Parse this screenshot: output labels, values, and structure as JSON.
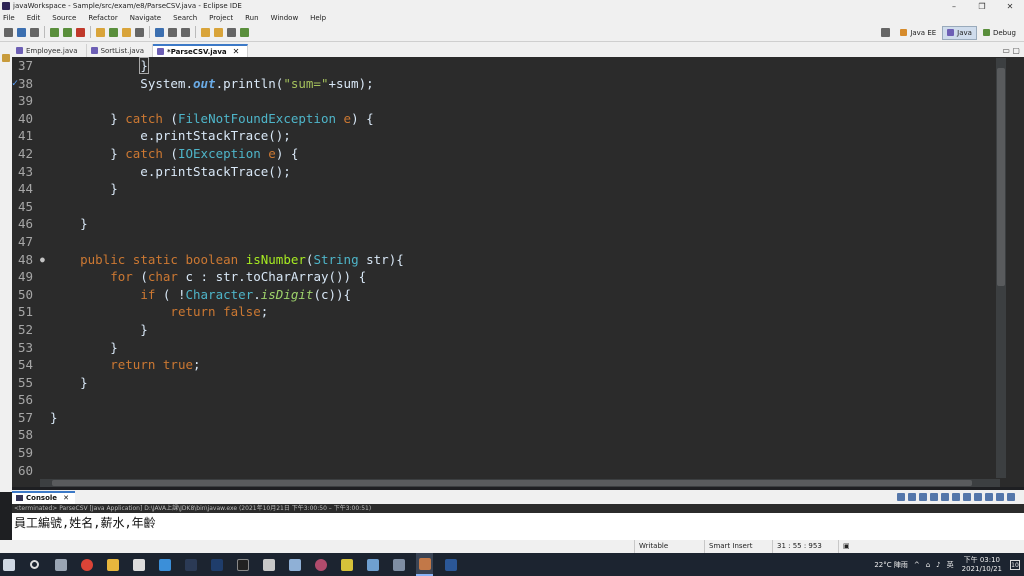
{
  "window": {
    "title": "javaWorkspace - Sample/src/exam/e8/ParseCSV.java - Eclipse IDE",
    "minimize": "–",
    "maximize": "❐",
    "close": "✕"
  },
  "menu": [
    "File",
    "Edit",
    "Source",
    "Refactor",
    "Navigate",
    "Search",
    "Project",
    "Run",
    "Window",
    "Help"
  ],
  "perspectives": [
    {
      "label": "Java EE",
      "active": false
    },
    {
      "label": "Java",
      "active": true
    },
    {
      "label": "Debug",
      "active": false
    }
  ],
  "editor_tabs": [
    {
      "label": "Employee.java",
      "active": false
    },
    {
      "label": "SortList.java",
      "active": false
    },
    {
      "label": "*ParseCSV.java",
      "active": true,
      "close": "✕"
    }
  ],
  "code_lines": [
    {
      "n": "37",
      "html": "<span class=\"pl\">            </span><span class=\"pl brk\">}</span>"
    },
    {
      "n": "38",
      "mark": "✓",
      "html": "<span class=\"pl\">            System.</span><span class=\"fld\">out</span><span class=\"pl\">.println(</span><span class=\"st\">\"sum=\"</span><span class=\"pl\">+sum);</span>"
    },
    {
      "n": "39",
      "html": ""
    },
    {
      "n": "40",
      "html": "<span class=\"pl\">        } </span><span class=\"kw\">catch</span><span class=\"pl\"> (</span><span class=\"ty\">FileNotFoundException</span><span class=\"pl\"> </span><span class=\"kw\">e</span><span class=\"pl\">) {</span>"
    },
    {
      "n": "41",
      "html": "<span class=\"pl\">            e.printStackTrace();</span>"
    },
    {
      "n": "42",
      "html": "<span class=\"pl\">        } </span><span class=\"kw\">catch</span><span class=\"pl\"> (</span><span class=\"ty\">IOException</span><span class=\"pl\"> </span><span class=\"kw\">e</span><span class=\"pl\">) {</span>"
    },
    {
      "n": "43",
      "html": "<span class=\"pl\">            e.printStackTrace();</span>"
    },
    {
      "n": "44",
      "html": "<span class=\"pl\">        }</span>"
    },
    {
      "n": "45",
      "html": ""
    },
    {
      "n": "46",
      "html": "<span class=\"pl\">    }</span>"
    },
    {
      "n": "47",
      "html": ""
    },
    {
      "n": "48",
      "dot": "●",
      "html": "<span class=\"pl\">    </span><span class=\"kw\">public static boolean</span><span class=\"pl\"> </span><span class=\"mth\">isNumber</span><span class=\"pl\">(</span><span class=\"ty\">String</span><span class=\"pl\"> </span><span class=\"var\">str</span><span class=\"pl\">){</span>"
    },
    {
      "n": "49",
      "html": "<span class=\"pl\">        </span><span class=\"kw\">for</span><span class=\"pl\"> (</span><span class=\"kw\">char</span><span class=\"pl\"> </span><span class=\"var\">c</span><span class=\"pl\"> : str.toCharArray()) {</span>"
    },
    {
      "n": "50",
      "html": "<span class=\"pl\">            </span><span class=\"kw\">if</span><span class=\"pl\"> ( !</span><span class=\"ty\">Character</span><span class=\"pl\">.</span><span class=\"it\">isDigit</span><span class=\"pl\">(c)){</span>"
    },
    {
      "n": "51",
      "html": "<span class=\"pl\">                </span><span class=\"kw\">return false</span><span class=\"pl\">;</span>"
    },
    {
      "n": "52",
      "html": "<span class=\"pl\">            }</span>"
    },
    {
      "n": "53",
      "html": "<span class=\"pl\">        }</span>"
    },
    {
      "n": "54",
      "html": "<span class=\"pl\">        </span><span class=\"kw\">return true</span><span class=\"pl\">;</span>"
    },
    {
      "n": "55",
      "html": "<span class=\"pl\">    }</span>"
    },
    {
      "n": "56",
      "html": ""
    },
    {
      "n": "57",
      "html": "<span class=\"pl\">}</span>"
    },
    {
      "n": "58",
      "html": ""
    },
    {
      "n": "59",
      "html": ""
    },
    {
      "n": "60",
      "html": ""
    }
  ],
  "console": {
    "tab_label": "Console",
    "close": "✕",
    "header": "<terminated> ParseCSV [Java Application] D:\\JAVA上課\\JDK8\\bin\\javaw.exe  (2021年10月21日 下午3:00:50 – 下午3:00:51)",
    "output": "員工編號,姓名,薪水,年齡"
  },
  "statusbar": {
    "writable": "Writable",
    "insert_mode": "Smart Insert",
    "position": "31 : 55 : 953"
  },
  "taskbar": {
    "weather": "22°C 陣雨",
    "ime": "英",
    "time": "下午 03:10",
    "date": "2021/10/21",
    "notifications": "10"
  },
  "colors": {
    "editor_bg": "#2b2b2b",
    "keyword": "#cc7832",
    "type": "#4eb5c9",
    "string": "#a5c25c",
    "method_decl": "#a7ec21",
    "static_field": "#6aabe6"
  }
}
